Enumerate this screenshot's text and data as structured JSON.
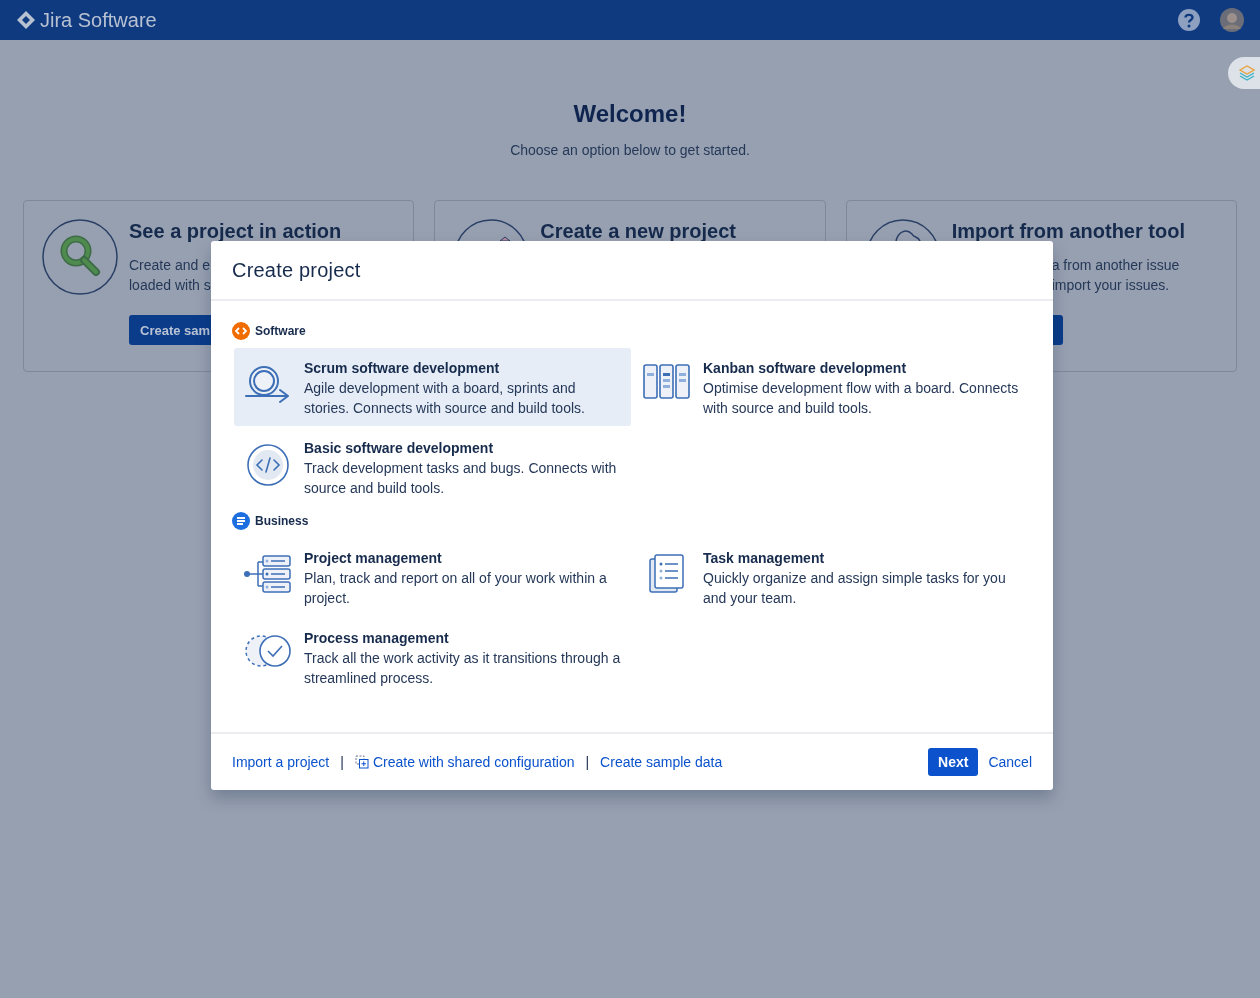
{
  "header": {
    "product": "Jira Software"
  },
  "welcome": {
    "title": "Welcome!",
    "subtitle": "Choose an option below to get started."
  },
  "cards": [
    {
      "kind": "magnifier",
      "title": "See a project in action",
      "lines": [
        "Create and e",
        "loaded with s"
      ],
      "button": "Create sam",
      "button_shown": true
    },
    {
      "kind": "new",
      "title": "Create a new project",
      "button_shown": false
    },
    {
      "kind": "import",
      "title": "Import from another tool",
      "lines": [
        "a from another issue",
        "import your issues."
      ],
      "button_shown": true
    }
  ],
  "modal": {
    "title": "Create project",
    "sections": [
      {
        "kind": "software",
        "title": "Software",
        "items": [
          {
            "kind": "scrum",
            "title": "Scrum software development",
            "description": "Agile development with a board, sprints and stories. Connects with source and build tools.",
            "selected": true
          },
          {
            "kind": "kanban",
            "title": "Kanban software development",
            "description": "Optimise development flow with a board. Connects with source and build tools.",
            "selected": false
          },
          {
            "kind": "basic",
            "title": "Basic software development",
            "description": "Track development tasks and bugs. Connects with source and build tools.",
            "selected": false
          }
        ]
      },
      {
        "kind": "business",
        "title": "Business",
        "items": [
          {
            "kind": "project",
            "title": "Project management",
            "description": "Plan, track and report on all of your work within a project.",
            "selected": false
          },
          {
            "kind": "task",
            "title": "Task management",
            "description": "Quickly organize and assign simple tasks for you and your team.",
            "selected": false
          },
          {
            "kind": "process",
            "title": "Process management",
            "description": "Track all the work activity as it transitions through a streamlined process.",
            "selected": false
          }
        ]
      }
    ],
    "footer_links": [
      {
        "kind": "link",
        "text": "Import a project"
      },
      {
        "kind": "separator",
        "text": "|"
      },
      {
        "kind": "shared-link",
        "text": "Create with shared configuration"
      },
      {
        "kind": "separator",
        "text": "|"
      },
      {
        "kind": "link",
        "text": "Create sample data"
      }
    ],
    "buttons": [
      {
        "kind": "primary",
        "label": "Next"
      },
      {
        "kind": "link",
        "label": "Cancel"
      }
    ]
  }
}
